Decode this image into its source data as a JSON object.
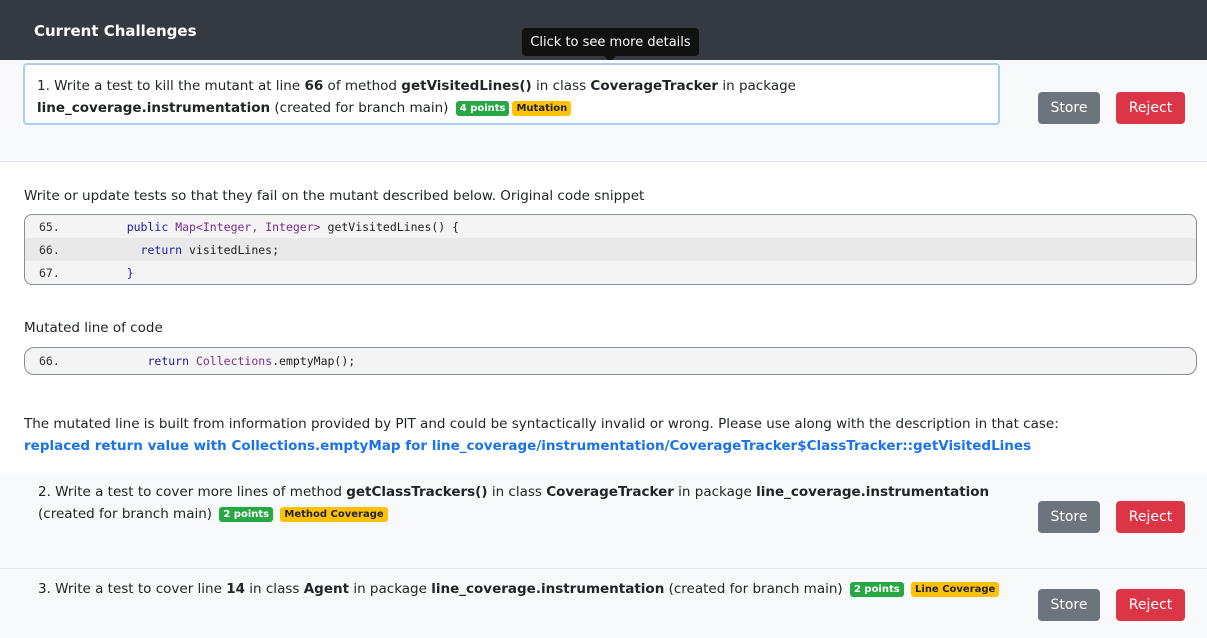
{
  "header": {
    "title": "Current Challenges"
  },
  "tooltip": {
    "text": "Click to see more details"
  },
  "challenges": [
    {
      "prefix": "1. Write a test to kill the mutant at line ",
      "line": "66",
      "mid1": " of method ",
      "method": "getVisitedLines()",
      "mid2": " in class ",
      "class": "CoverageTracker",
      "mid3": " in package",
      "package": "line_coverage.instrumentation",
      "suffix": " (created for branch main)",
      "points": "4 points",
      "type": "Mutation",
      "store": "Store",
      "reject": "Reject"
    },
    {
      "prefix": "2. Write a test to cover more lines of method ",
      "method": "getClassTrackers()",
      "mid1": " in class ",
      "class": "CoverageTracker",
      "mid2": " in package ",
      "package": "line_coverage.instrumentation",
      "suffix": "(created for branch main)",
      "points": "2 points",
      "type": "Method Coverage",
      "store": "Store",
      "reject": "Reject"
    },
    {
      "prefix": "3. Write a test to cover line ",
      "line": "14",
      "mid1": " in class ",
      "class": "Agent",
      "mid2": " in package ",
      "package": "line_coverage.instrumentation",
      "suffix": " (created for branch main)",
      "points": "2 points",
      "type": "Line Coverage",
      "store": "Store",
      "reject": "Reject"
    }
  ],
  "details": {
    "intro": "Write or update tests so that they fail on the mutant described below. Original code snippet",
    "snippet": [
      {
        "ln": "65.",
        "a": "    ",
        "kw": "public",
        "b": " ",
        "ty": "Map<Integer, Integer>",
        "c": " getVisitedLines() {"
      },
      {
        "ln": "66.",
        "a": "      ",
        "kw": "return",
        "c": " visitedLines;"
      },
      {
        "ln": "67.",
        "a": "    ",
        "c": "}"
      }
    ],
    "mutated_label": "Mutated line of code",
    "mutated": {
      "ln": "66.",
      "a": "       ",
      "kw": "return",
      "b": " ",
      "ty": "Collections",
      "c": ".emptyMap();"
    },
    "note": "The mutated line is built from information provided by PIT and could be syntactically invalid or wrong. Please use along with the description in that case:",
    "description": "replaced return value with Collections.emptyMap for line_coverage/instrumentation/CoverageTracker$ClassTracker::getVisitedLines"
  }
}
